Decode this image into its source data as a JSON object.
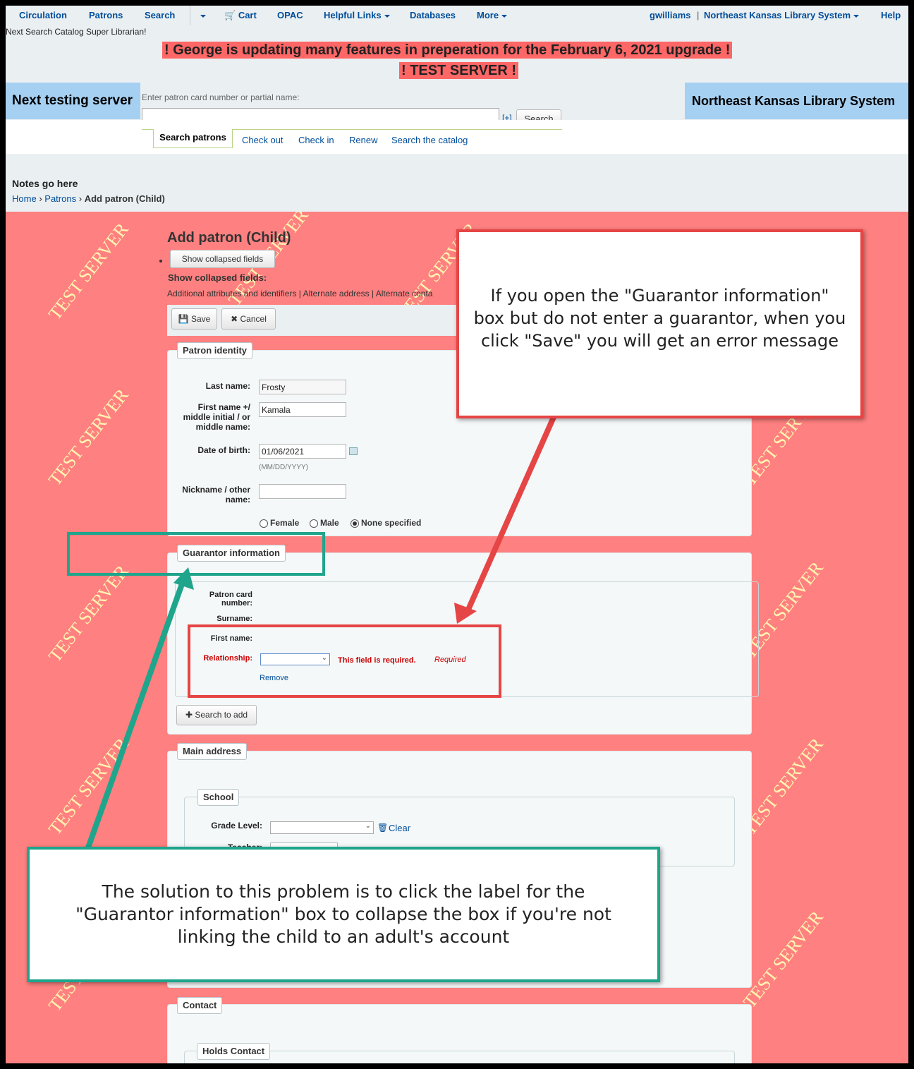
{
  "nav": {
    "items": [
      "Circulation",
      "Patrons",
      "Search",
      "Cart",
      "OPAC",
      "Helpful Links",
      "Databases",
      "More"
    ],
    "user": "gwilliams",
    "library": "Northeast Kansas Library System",
    "help": "Help",
    "subline": "Next Search Catalog Super Librarian!"
  },
  "banner": {
    "line1": "! George is updating many features in preperation for the February 6, 2021 upgrade !",
    "line2": "! TEST SERVER !"
  },
  "header": {
    "left": "Next testing server",
    "right": "Northeast Kansas Library System",
    "search_label": "Enter patron card number or partial name:",
    "search_value": "",
    "plus": "[+]",
    "search_button": "Search"
  },
  "tabs": {
    "active": "Search patrons",
    "links": [
      "Check out",
      "Check in",
      "Renew",
      "Search the catalog"
    ]
  },
  "notes": "Notes go here",
  "breadcrumb": {
    "home": "Home",
    "sep": "›",
    "patrons": "Patrons",
    "current": "Add patron (Child)"
  },
  "watermark": "TEST SERVER",
  "page": {
    "title": "Add patron (Child)",
    "show_collapsed_button": "Show collapsed fields",
    "show_collapsed_label": "Show collapsed fields:",
    "collapsed_list": "Additional attributes and identifiers | Alternate address | Alternate conta",
    "save": "Save",
    "cancel": "Cancel"
  },
  "identity": {
    "legend": "Patron identity",
    "last_name_label": "Last name:",
    "last_name": "Frosty",
    "first_name_label": "First name +/ middle initial / or middle name:",
    "first_name": "Kamala",
    "dob_label": "Date of birth:",
    "dob": "01/06/2021",
    "dob_hint": "(MM/DD/YYYY)",
    "nickname_label": "Nickname / other name:",
    "nickname": "",
    "gender": [
      "Female",
      "Male",
      "None specified"
    ],
    "gender_selected": "None specified"
  },
  "guarantor": {
    "legend": "Guarantor information",
    "card_label": "Patron card number:",
    "surname_label": "Surname:",
    "first_name_label": "First name:",
    "relationship_label": "Relationship:",
    "required_error": "This field is required.",
    "required_tag": "Required",
    "remove": "Remove",
    "search_to_add": "Search to add"
  },
  "address": {
    "legend": "Main address",
    "school_legend": "School",
    "grade_label": "Grade Level:",
    "clear": "Clear",
    "teacher_label": "Teacher:"
  },
  "contact": {
    "legend": "Contact",
    "holds_legend": "Holds Contact"
  },
  "callouts": {
    "red": "If you open the \"Guarantor information\" box but do not enter a guarantor, when you click \"Save\" you will get an error message",
    "green": "The solution to this problem is to click the label for the \"Guarantor information\" box to collapse the box if you're not linking the child to an adult's account"
  },
  "colors": {
    "link": "#004d99",
    "test_bg": "#ff8080",
    "banner": "#ff6666",
    "header_blue": "#a6d0f2",
    "red_callout": "#e64545",
    "green_callout": "#1fa58c"
  }
}
